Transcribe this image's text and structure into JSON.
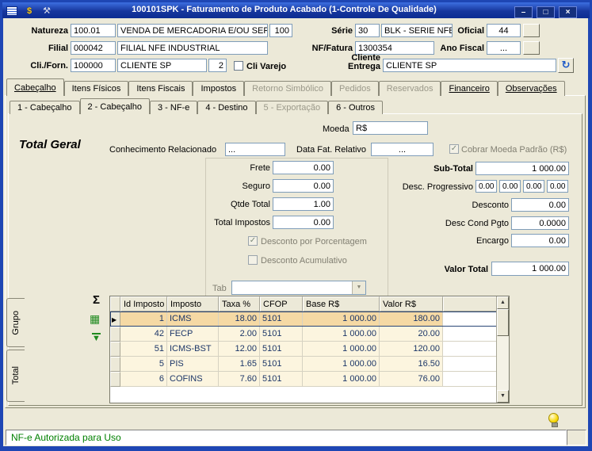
{
  "window": {
    "title": "100101SPK - Faturamento de Produto Acabado (1-Controle De Qualidade)"
  },
  "icons": {
    "dollar": "$",
    "tools": "⚒",
    "minimize": "–",
    "maximize": "□",
    "close": "×",
    "refresh": "↻",
    "sigma": "Σ",
    "grid_export": "▦",
    "arrow_down": "▼",
    "check": "✓",
    "row_marker": "▶",
    "dropdown_arrow": "▼",
    "scroll_up": "▲",
    "scroll_down": "▼"
  },
  "header": {
    "natureza": {
      "label": "Natureza",
      "code": "100.01",
      "desc": "VENDA DE MERCADORIA E/OU SERVI",
      "aux": "100"
    },
    "serie": {
      "label": "Série",
      "code": "30",
      "desc": "BLK - SERIE NFE"
    },
    "oficial": {
      "label": "Oficial",
      "value": "44"
    },
    "filial": {
      "label": "Filial",
      "code": "000042",
      "desc": "FILIAL NFE INDUSTRIAL"
    },
    "nf_fatura": {
      "label": "NF/Fatura",
      "value": "1300354"
    },
    "ano_fiscal": {
      "label": "Ano Fiscal",
      "value": "..."
    },
    "cli_forn": {
      "label": "Cli./Forn.",
      "code": "100000",
      "desc": "CLIENTE SP",
      "aux": "2"
    },
    "cli_varejo": {
      "label": "Cli Varejo"
    },
    "cliente_entrega": {
      "label": "Cliente Entrega",
      "value": "CLIENTE SP"
    }
  },
  "tabs_main": [
    {
      "label": "Cabeçalho"
    },
    {
      "label": "Itens Físicos"
    },
    {
      "label": "Itens Fiscais"
    },
    {
      "label": "Impostos"
    },
    {
      "label": "Retorno Simbólico"
    },
    {
      "label": "Pedidos"
    },
    {
      "label": "Reservados"
    },
    {
      "label": "Financeiro"
    },
    {
      "label": "Observações"
    }
  ],
  "tabs_sub": [
    {
      "label": "1 - Cabeçalho"
    },
    {
      "label": "2 - Cabeçalho"
    },
    {
      "label": "3 - NF-e"
    },
    {
      "label": "4 - Destino"
    },
    {
      "label": "5 - Exportação"
    },
    {
      "label": "6 - Outros"
    }
  ],
  "totals": {
    "moeda_label": "Moeda",
    "moeda_value": "R$",
    "section_title": "Total Geral",
    "conhecimento_label": "Conhecimento Relacionado",
    "conhecimento_value": "...",
    "data_fat_label": "Data Fat. Relativo",
    "data_fat_value": "...",
    "cobrar_moeda_label": "Cobrar Moeda Padrão (R$)",
    "frete_label": "Frete",
    "frete_value": "0.00",
    "seguro_label": "Seguro",
    "seguro_value": "0.00",
    "qtde_label": "Qtde Total",
    "qtde_value": "1.00",
    "total_impostos_label": "Total Impostos",
    "total_impostos_value": "0.00",
    "desc_porcentagem_label": "Desconto por Porcentagem",
    "desc_acumulativo_label": "Desconto Acumulativo",
    "tab_label": "Tab",
    "subtotal_label": "Sub-Total",
    "subtotal_value": "1 000.00",
    "desc_progressivo_label": "Desc. Progressivo",
    "desc_progressivo_values": [
      "0.00",
      "0.00",
      "0.00",
      "0.00"
    ],
    "desconto_label": "Desconto",
    "desconto_value": "0.00",
    "desc_cond_pgto_label": "Desc Cond Pgto",
    "desc_cond_pgto_value": "0.0000",
    "encargo_label": "Encargo",
    "encargo_value": "0.00",
    "valor_total_label": "Valor Total",
    "valor_total_value": "1 000.00"
  },
  "side_tabs": [
    {
      "label": "Grupo"
    },
    {
      "label": "Total"
    }
  ],
  "grid": {
    "columns": [
      "Id Imposto",
      "Imposto",
      "Taxa %",
      "CFOP",
      "Base R$",
      "Valor R$"
    ],
    "rows": [
      [
        "1",
        "ICMS",
        "18.00",
        "5101",
        "1 000.00",
        "180.00"
      ],
      [
        "42",
        "FECP",
        "2.00",
        "5101",
        "1 000.00",
        "20.00"
      ],
      [
        "51",
        "ICMS-BST",
        "12.00",
        "5101",
        "1 000.00",
        "120.00"
      ],
      [
        "5",
        "PIS",
        "1.65",
        "5101",
        "1 000.00",
        "16.50"
      ],
      [
        "6",
        "COFINS",
        "7.60",
        "5101",
        "1 000.00",
        "76.00"
      ]
    ]
  },
  "status": {
    "text": "NF-e Autorizada para Uso"
  }
}
